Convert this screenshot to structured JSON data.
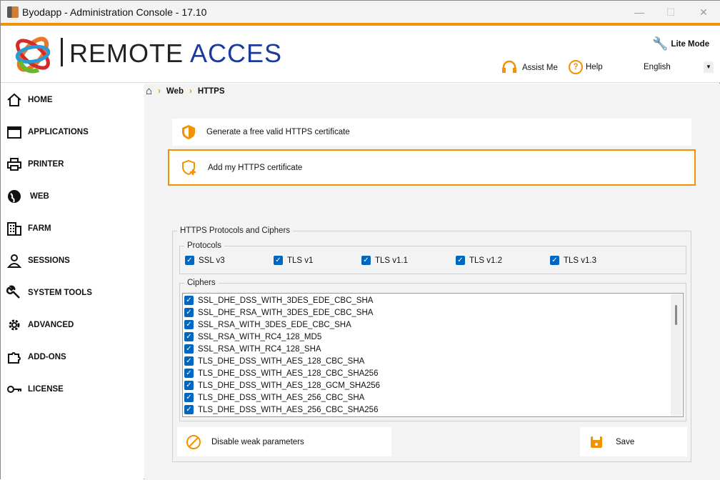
{
  "window": {
    "title": "Byodapp - Administration Console - 17.10"
  },
  "header": {
    "logo_text_1": "REMOTE",
    "logo_text_2": "ACCES",
    "lite_mode": "Lite Mode",
    "assist": "Assist Me",
    "help": "Help",
    "language": "English"
  },
  "breadcrumb": [
    "Web",
    "HTTPS"
  ],
  "sidebar": {
    "items": [
      {
        "label": "HOME"
      },
      {
        "label": "APPLICATIONS"
      },
      {
        "label": "PRINTER"
      },
      {
        "label": "WEB"
      },
      {
        "label": "FARM"
      },
      {
        "label": "SESSIONS"
      },
      {
        "label": "SYSTEM TOOLS"
      },
      {
        "label": "ADVANCED"
      },
      {
        "label": "ADD-ONS"
      },
      {
        "label": "LICENSE"
      }
    ]
  },
  "actions": {
    "generate": "Generate a free valid HTTPS certificate",
    "add": "Add my HTTPS certificate"
  },
  "group": {
    "title": "HTTPS Protocols and Ciphers",
    "protocols_title": "Protocols",
    "ciphers_title": "Ciphers"
  },
  "protocols": [
    {
      "label": "SSL v3",
      "checked": true
    },
    {
      "label": "TLS v1",
      "checked": true
    },
    {
      "label": "TLS v1.1",
      "checked": true
    },
    {
      "label": "TLS v1.2",
      "checked": true
    },
    {
      "label": "TLS v1.3",
      "checked": true
    }
  ],
  "ciphers": [
    {
      "label": "SSL_DHE_DSS_WITH_3DES_EDE_CBC_SHA",
      "checked": true
    },
    {
      "label": "SSL_DHE_RSA_WITH_3DES_EDE_CBC_SHA",
      "checked": true
    },
    {
      "label": "SSL_RSA_WITH_3DES_EDE_CBC_SHA",
      "checked": true
    },
    {
      "label": "SSL_RSA_WITH_RC4_128_MD5",
      "checked": true
    },
    {
      "label": "SSL_RSA_WITH_RC4_128_SHA",
      "checked": true
    },
    {
      "label": "TLS_DHE_DSS_WITH_AES_128_CBC_SHA",
      "checked": true
    },
    {
      "label": "TLS_DHE_DSS_WITH_AES_128_CBC_SHA256",
      "checked": true
    },
    {
      "label": "TLS_DHE_DSS_WITH_AES_128_GCM_SHA256",
      "checked": true
    },
    {
      "label": "TLS_DHE_DSS_WITH_AES_256_CBC_SHA",
      "checked": true
    },
    {
      "label": "TLS_DHE_DSS_WITH_AES_256_CBC_SHA256",
      "checked": true
    }
  ],
  "buttons": {
    "disable_weak": "Disable weak parameters",
    "save": "Save"
  },
  "colors": {
    "accent": "#f39200",
    "checkbox": "#0067c0",
    "logo_blue": "#1a3a9c"
  }
}
